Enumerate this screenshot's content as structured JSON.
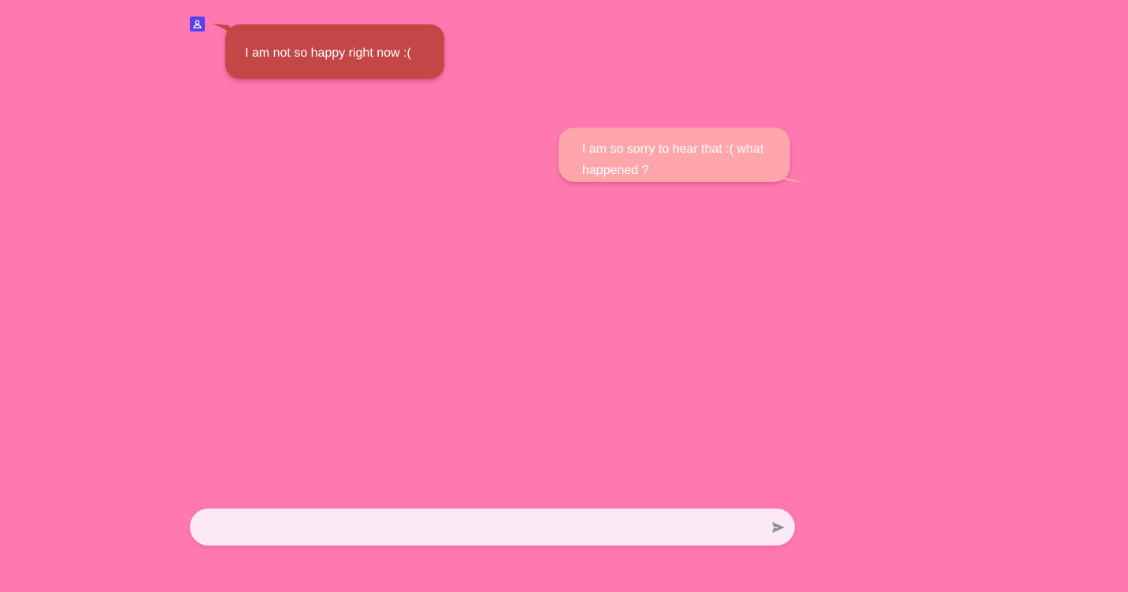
{
  "chat": {
    "messages": [
      {
        "sender": "other",
        "text": "I am not so happy right now :("
      },
      {
        "sender": "self",
        "text": "I am so sorry to hear that :( what happened ?"
      }
    ]
  },
  "composer": {
    "value": "",
    "placeholder": ""
  },
  "icons": {
    "avatar": "user-icon",
    "send": "send-icon"
  },
  "colors": {
    "background": "#ff79b0",
    "incoming_bubble": "#c44646",
    "outgoing_bubble": "#ffa6ad",
    "avatar": "#5b3ff0",
    "composer": "#fbe9f3"
  }
}
